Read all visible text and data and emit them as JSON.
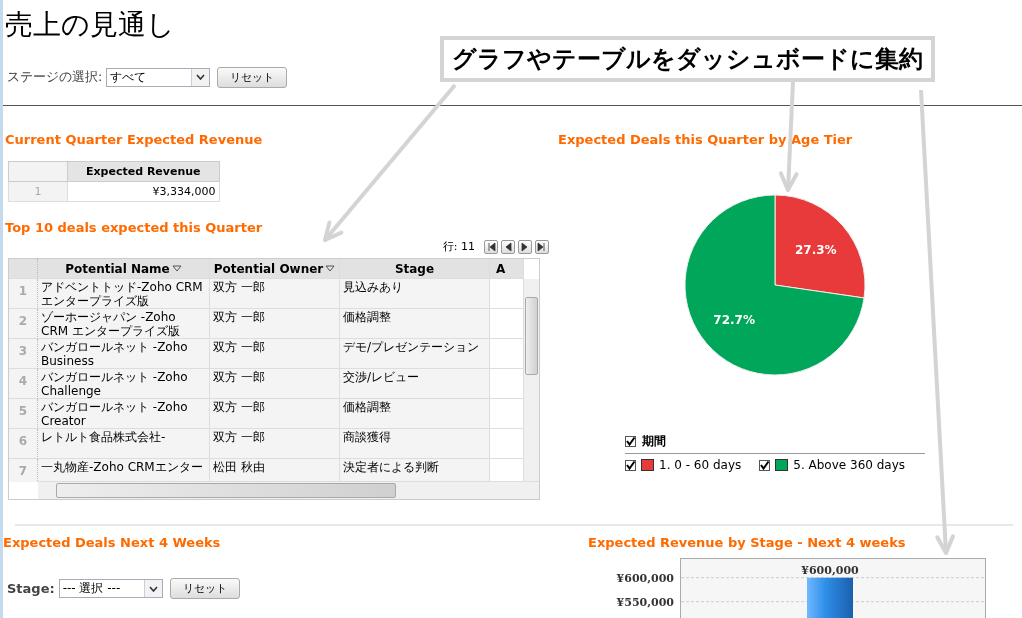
{
  "title": "売上の見通し",
  "stage_filter": {
    "label": "ステージの選択:",
    "value": "すべて",
    "button": "リセット"
  },
  "callout": {
    "text": "グラフやテーブルをダッシュボードに集約"
  },
  "current_quarter": {
    "title": "Current Quarter Expected Revenue",
    "columns": [
      "Expected Revenue"
    ],
    "rows": [
      {
        "number": "1",
        "cells": [
          "¥3,334,000"
        ]
      }
    ]
  },
  "top_deals": {
    "title": "Top 10 deals expected this Quarter",
    "row_count": "行: 11",
    "columns": [
      {
        "label": "Potential Name",
        "sortable": true
      },
      {
        "label": "Potential Owner",
        "sortable": true
      },
      {
        "label": "Stage",
        "sortable": false
      },
      {
        "label": "A",
        "sortable": false
      }
    ],
    "rows": [
      {
        "number": "1",
        "cells": [
          "アドベントトッド-Zoho CRM エンタープライズ版",
          "双方 一郎",
          "見込みあり"
        ]
      },
      {
        "number": "2",
        "cells": [
          "ゾーホージャパン -Zoho CRM エンタープライズ版",
          "双方 一郎",
          "価格調整"
        ]
      },
      {
        "number": "3",
        "cells": [
          "バンガロールネット -Zoho Business",
          "双方 一郎",
          "デモ/プレゼンテーション"
        ]
      },
      {
        "number": "4",
        "cells": [
          "バンガロールネット -Zoho Challenge",
          "双方 一郎",
          "交渉/レビュー"
        ]
      },
      {
        "number": "5",
        "cells": [
          "バンガロールネット -Zoho Creator",
          "双方 一郎",
          "価格調整"
        ]
      },
      {
        "number": "6",
        "cells": [
          "レトルト食品株式会社-",
          "双方 一郎",
          "商談獲得"
        ]
      },
      {
        "number": "7",
        "cells": [
          "一丸物産-Zoho CRMエンター",
          "松田 秋由",
          "決定者による判断"
        ]
      }
    ]
  },
  "age_tier": {
    "title": "Expected Deals this Quarter by Age Tier",
    "chart_data": {
      "type": "pie",
      "values": [
        27.3,
        72.7
      ],
      "value_labels": [
        "27.3%",
        "72.7%"
      ]
    },
    "legend": {
      "title": "期間",
      "checked": true,
      "items": [
        {
          "label": "1. 0 - 60 days",
          "color": "#e8393b",
          "checked": true
        },
        {
          "label": "5. Above 360 days",
          "color": "#00a65a",
          "checked": true
        }
      ]
    }
  },
  "next_4_weeks": {
    "title": "Expected Deals Next 4 Weeks",
    "stage_filter": {
      "label": "Stage:",
      "value": "--- 選択 ---",
      "button": "リセット"
    }
  },
  "revenue_by_stage": {
    "title": "Expected Revenue by Stage - Next 4 weeks",
    "chart_data": {
      "type": "bar",
      "values": [
        600000
      ],
      "ylim": [
        0,
        640000
      ],
      "yticks": [
        {
          "value": 550000,
          "label": "¥550,000"
        },
        {
          "value": 600000,
          "label": "¥600,000"
        }
      ],
      "value_labels": [
        "¥600,000"
      ]
    }
  }
}
